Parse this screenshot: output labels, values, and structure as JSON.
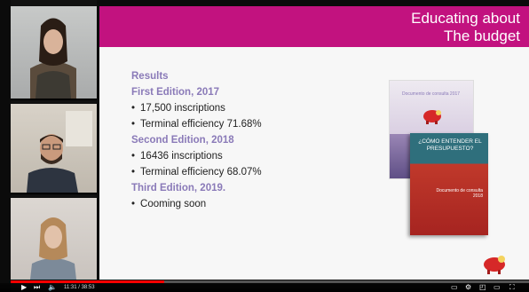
{
  "slide": {
    "title_line1": "Educating about",
    "title_line2": "The budget",
    "results_heading": "Results",
    "sections": [
      {
        "heading": "First Edition, 2017",
        "bullets": [
          "17,500 inscriptions",
          "Terminal efficiency 71.68%"
        ]
      },
      {
        "heading": "Second Edition, 2018",
        "bullets": [
          "16436 inscriptions",
          "Terminal efficiency 68.07%"
        ]
      },
      {
        "heading": "Third Edition, 2019.",
        "bullets": [
          "Cooming soon"
        ]
      }
    ],
    "book_back_title": "Documento de consulta 2017",
    "book_front_title": "¿CÓMO ENTENDER EL PRESUPUESTO?",
    "book_front_subtitle": "Documento de consulta 2018"
  },
  "player": {
    "time": "11:31 / 38:53",
    "progress_fraction": 0.296
  },
  "colors": {
    "banner": "#c2127f",
    "heading": "#8a7ab8",
    "progress": "#ff0000"
  }
}
